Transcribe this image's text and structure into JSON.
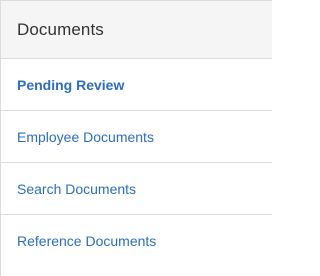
{
  "panel": {
    "title": "Documents",
    "items": [
      {
        "label": "Pending Review",
        "active": true
      },
      {
        "label": "Employee Documents",
        "active": false
      },
      {
        "label": "Search Documents",
        "active": false
      },
      {
        "label": "Reference Documents",
        "active": false
      }
    ]
  },
  "colors": {
    "link": "#2a6fbd",
    "header_background": "#f5f5f5",
    "border": "#dcdcdc",
    "title_text": "#333333"
  }
}
